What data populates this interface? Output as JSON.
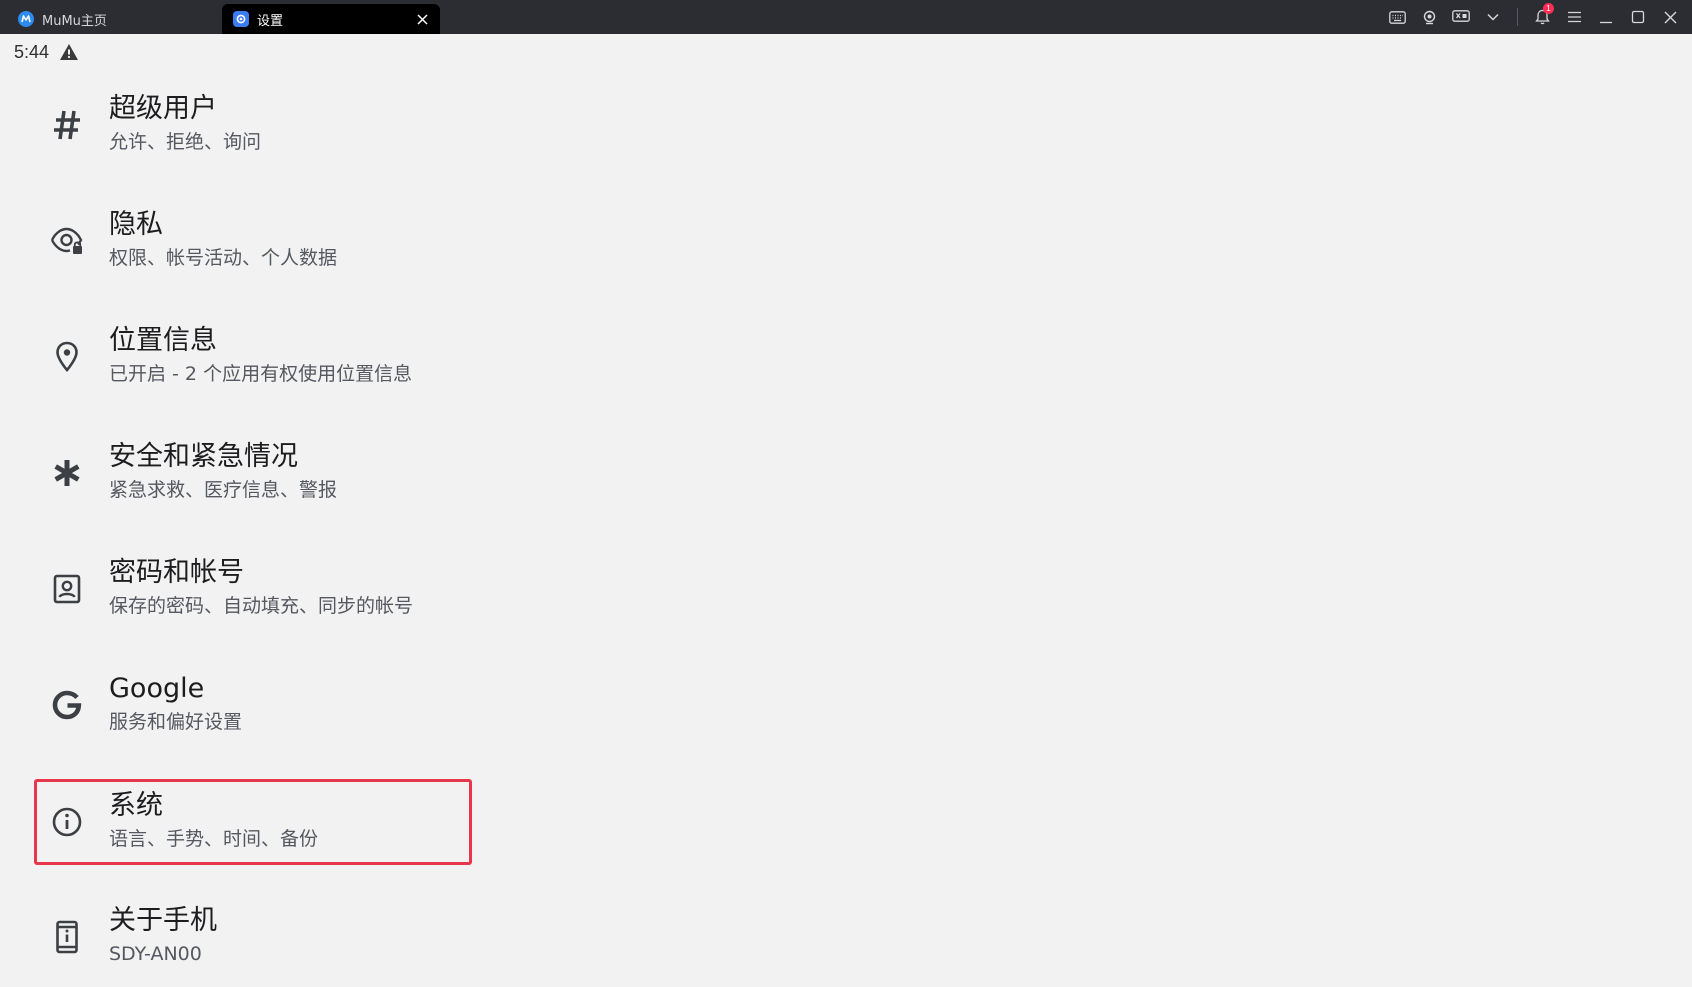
{
  "titlebar": {
    "tabs": [
      {
        "label": "MuMu主页",
        "icon": "mumu-logo-icon"
      },
      {
        "label": "设置",
        "icon": "settings-gear-icon"
      }
    ],
    "notification_count": "1",
    "controls": [
      "keyboard-icon",
      "gamepad-icon",
      "screen-record-icon",
      "chevron-down-icon",
      "bell-icon",
      "menu-icon",
      "minimize-icon",
      "maximize-icon",
      "close-icon"
    ]
  },
  "status_bar": {
    "time": "5:44",
    "icon": "warning-icon"
  },
  "settings": {
    "items": [
      {
        "title": "超级用户",
        "subtitle": "允许、拒绝、询问",
        "icon": "hash-icon"
      },
      {
        "title": "隐私",
        "subtitle": "权限、帐号活动、个人数据",
        "icon": "eye-lock-icon"
      },
      {
        "title": "位置信息",
        "subtitle": "已开启 - 2 个应用有权使用位置信息",
        "icon": "location-pin-icon"
      },
      {
        "title": "安全和紧急情况",
        "subtitle": "紧急求救、医疗信息、警报",
        "icon": "asterisk-icon"
      },
      {
        "title": "密码和帐号",
        "subtitle": "保存的密码、自动填充、同步的帐号",
        "icon": "account-box-icon"
      },
      {
        "title": "Google",
        "subtitle": "服务和偏好设置",
        "icon": "google-g-icon"
      },
      {
        "title": "系统",
        "subtitle": "语言、手势、时间、备份",
        "icon": "info-icon",
        "highlighted": true
      },
      {
        "title": "关于手机",
        "subtitle": "SDY-AN00",
        "icon": "phone-info-icon"
      }
    ]
  },
  "colors": {
    "titlebar_bg": "#2b2d33",
    "screen_bg": "#f2f2f3",
    "highlight_border": "#e8374b",
    "badge": "#ff2d55"
  }
}
